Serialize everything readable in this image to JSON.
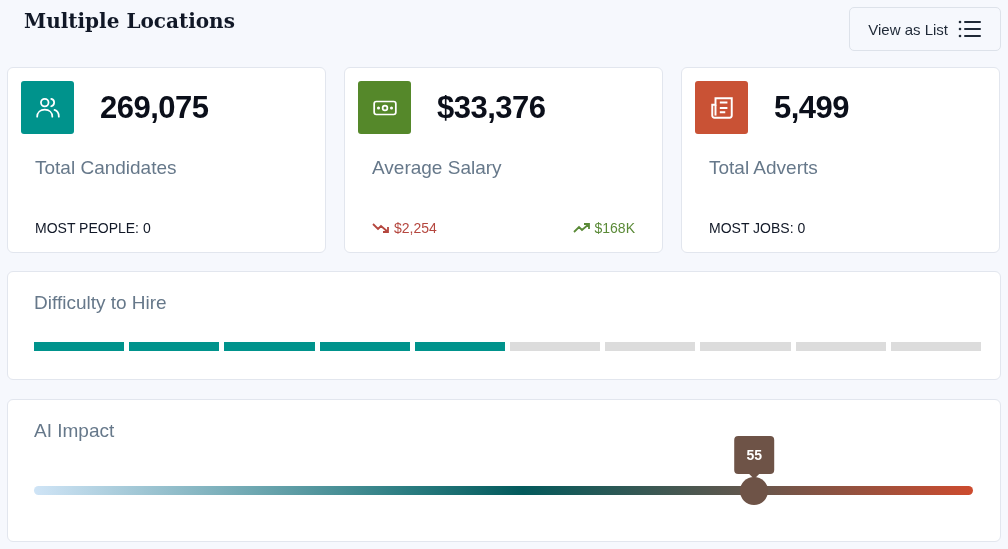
{
  "header": {
    "title": "Multiple Locations",
    "view_button": "View as List"
  },
  "stats": [
    {
      "kind": "people",
      "color": "#00938c",
      "value": "269,075",
      "label": "Total Candidates",
      "footer": [
        {
          "kind": "label",
          "text": "MOST PEOPLE: 0"
        }
      ]
    },
    {
      "kind": "money",
      "color": "#55882a",
      "value": "$33,376",
      "label": "Average Salary",
      "footer": [
        {
          "kind": "down",
          "text": "$2,254"
        },
        {
          "kind": "up",
          "text": "$168K"
        }
      ]
    },
    {
      "kind": "news",
      "color": "#c95235",
      "value": "5,499",
      "label": "Total Adverts",
      "footer": [
        {
          "kind": "label",
          "text": "MOST JOBS: 0"
        }
      ]
    }
  ],
  "difficulty": {
    "title": "Difficulty to Hire",
    "level": 0.5
  },
  "ai_impact": {
    "title": "AI Impact",
    "reading": "55",
    "level": 0.767
  }
}
